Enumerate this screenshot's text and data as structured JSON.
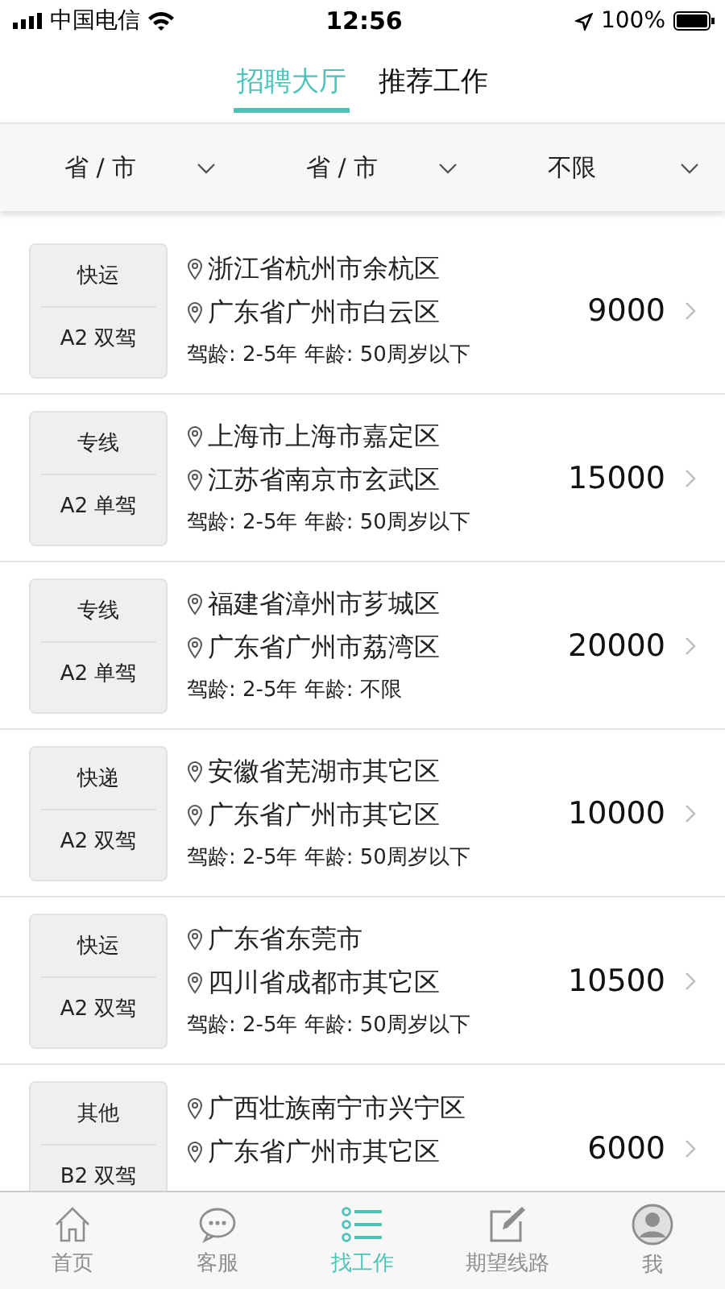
{
  "status_bar": {
    "carrier": "中国电信",
    "time": "12:56",
    "battery": "100%"
  },
  "tabs": [
    {
      "label": "招聘大厅",
      "selected": true
    },
    {
      "label": "推荐工作",
      "selected": false
    }
  ],
  "filters": [
    {
      "label": "省 / 市"
    },
    {
      "label": "省 / 市"
    },
    {
      "label": "不限"
    }
  ],
  "jobs": [
    {
      "type": "快运",
      "license": "A2 双驾",
      "from": "浙江省杭州市余杭区",
      "to": "广东省广州市白云区",
      "requirements": "驾龄: 2-5年 年龄: 50周岁以下",
      "salary": "9000"
    },
    {
      "type": "专线",
      "license": "A2 单驾",
      "from": "上海市上海市嘉定区",
      "to": "江苏省南京市玄武区",
      "requirements": "驾龄: 2-5年 年龄: 50周岁以下",
      "salary": "15000"
    },
    {
      "type": "专线",
      "license": "A2 单驾",
      "from": "福建省漳州市芗城区",
      "to": "广东省广州市荔湾区",
      "requirements": "驾龄: 2-5年 年龄: 不限",
      "salary": "20000"
    },
    {
      "type": "快递",
      "license": "A2 双驾",
      "from": "安徽省芜湖市其它区",
      "to": "广东省广州市其它区",
      "requirements": "驾龄: 2-5年 年龄: 50周岁以下",
      "salary": "10000"
    },
    {
      "type": "快运",
      "license": "A2 双驾",
      "from": "广东省东莞市",
      "to": "四川省成都市其它区",
      "requirements": "驾龄: 2-5年 年龄: 50周岁以下",
      "salary": "10500"
    },
    {
      "type": "其他",
      "license": "B2 双驾",
      "from": "广西壮族南宁市兴宁区",
      "to": "广东省广州市其它区",
      "salary": "6000"
    }
  ],
  "bottom_nav": [
    {
      "kind": "home",
      "label": "首页",
      "selected": false
    },
    {
      "kind": "chat",
      "label": "客服",
      "selected": false
    },
    {
      "kind": "list",
      "label": "找工作",
      "selected": true
    },
    {
      "kind": "edit",
      "label": "期望线路",
      "selected": false
    },
    {
      "kind": "user",
      "label": "我",
      "selected": false
    }
  ]
}
